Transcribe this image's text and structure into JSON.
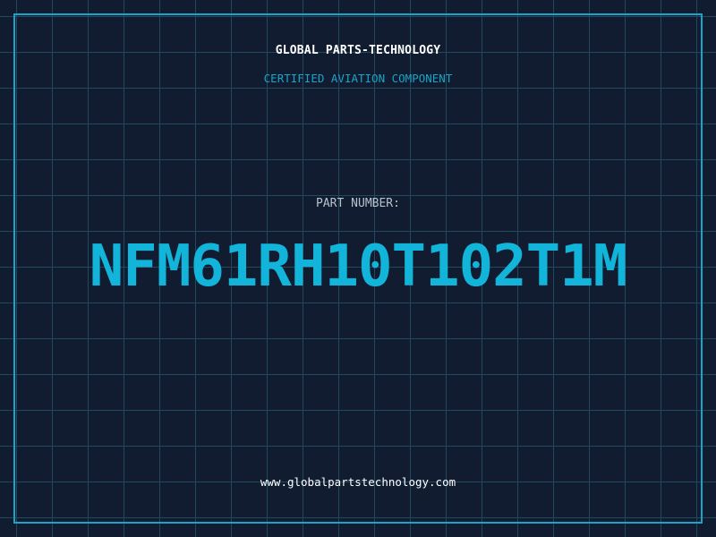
{
  "header": {
    "brand": "GLOBAL PARTS-TECHNOLOGY",
    "subtitle": "CERTIFIED AVIATION COMPONENT"
  },
  "part": {
    "label": "PART NUMBER:",
    "number": "NFM61RH10T102T1M"
  },
  "footer": {
    "url": "www.globalpartstechnology.com"
  },
  "colors": {
    "background": "#111c30",
    "grid": "#1f4a5f",
    "accent": "#1aa4c7",
    "part_number": "#12b5d9",
    "text": "#ffffff"
  }
}
